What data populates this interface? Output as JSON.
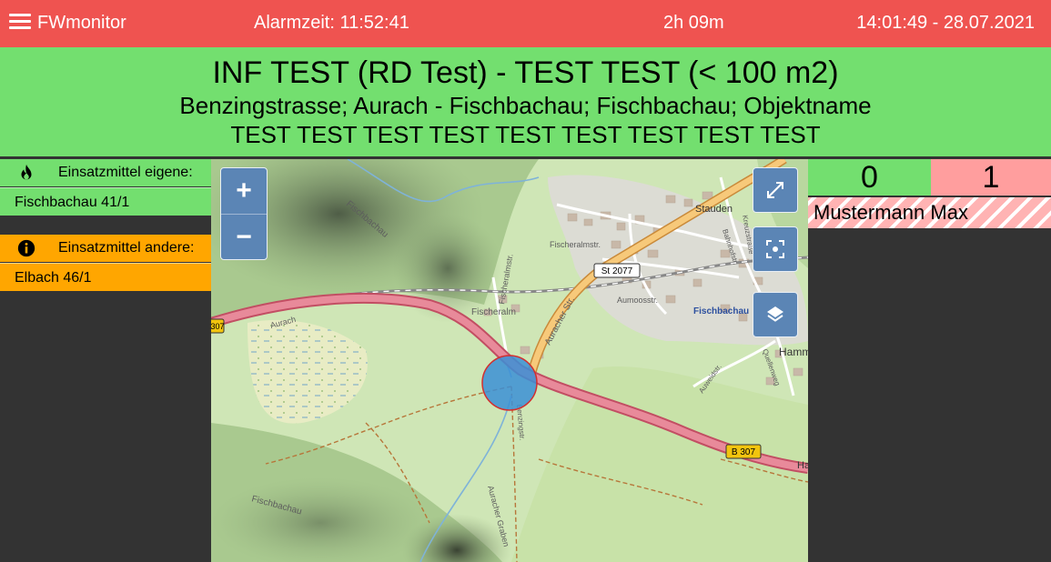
{
  "topbar": {
    "brand": "FWmonitor",
    "alarm_time": "Alarmzeit: 11:52:41",
    "elapsed": "2h 09m",
    "clock": "14:01:49 - 28.07.2021"
  },
  "alarm": {
    "line1": "INF TEST (RD Test) - TEST TEST (< 100 m2)",
    "line2": "Benzingstrasse; Aurach - Fischbachau; Fischbachau; Objektname",
    "line3": "TEST TEST TEST TEST TEST TEST TEST TEST TEST"
  },
  "resources": {
    "own": {
      "header": "Einsatzmittel eigene:",
      "icon": "fire-icon",
      "items": [
        "Fischbachau 41/1"
      ]
    },
    "other": {
      "header": "Einsatzmittel andere:",
      "icon": "info-icon",
      "items": [
        "Elbach 46/1"
      ]
    }
  },
  "map": {
    "zoom_in": "+",
    "zoom_out": "−",
    "labels": {
      "fischbachau_ridge": "Fischbachau",
      "fischeralm": "Fischeralm",
      "fischeralmstr_1": "Fischeralmstr.",
      "fischeralmstr_2": "Fischeralmstr.",
      "auracher_str": "Auracher Str.",
      "stauden": "Stauden",
      "st2077": "St 2077",
      "b307a": "B 307",
      "b307b": "307",
      "fischbachau_town": "Fischbachau",
      "hamm": "Hamm",
      "aurach": "Aurach",
      "aumoosstr": "Aumoosstr.",
      "fischbachau_sw": "Fischbachau",
      "auracher_graben": "Auracher Graben",
      "kreuzstr": "Kreuzstraße",
      "bahnhofstr": "Bahnhofstr.",
      "auweidstr": "Auweidstr.",
      "quellenweg": "Quellenweg",
      "benzingstr": "Benzingstr.",
      "ha": "Ha"
    }
  },
  "status": {
    "count_available": "0",
    "count_unavailable": "1",
    "persons": [
      "Mustermann Max"
    ]
  },
  "colors": {
    "header_red": "#ef5350",
    "banner_green": "#73df6f",
    "own_green": "#73df6f",
    "other_orange": "#ffa600",
    "count_pink": "#ff9e9e",
    "map_control_blue": "#5b85b5",
    "marker_blue": "#3b8fd6",
    "marker_border": "#d32f2f"
  }
}
